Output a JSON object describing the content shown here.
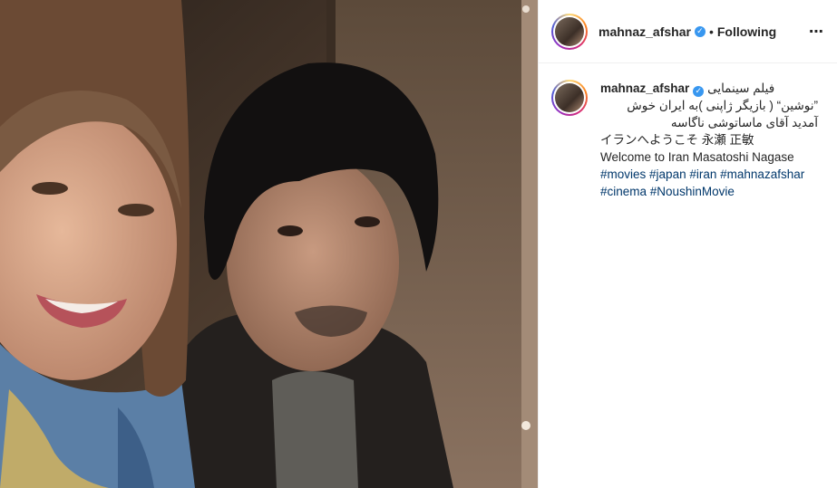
{
  "post": {
    "author": "mahnaz_afshar",
    "follow_status": "Following",
    "separator": "•",
    "more_icon": "⋯",
    "verified_icon": "✓"
  },
  "caption": {
    "author": "mahnaz_afshar",
    "line1": "فیلم سینمایی",
    "line2": "”نوشین“ ( بازیگر ژاپنی )به ایران خوش",
    "line3": "آمدید آقای ماساتوشی ناگاسه",
    "line4": "イランへようこそ 永瀬 正敏",
    "line5": "Welcome to Iran Masatoshi Nagase",
    "hashtags_row1": [
      "#movies",
      "#japan",
      "#iran",
      "#mahnazafshar"
    ],
    "hashtags_row2": [
      "#cinema",
      "#NoushinMovie"
    ]
  }
}
